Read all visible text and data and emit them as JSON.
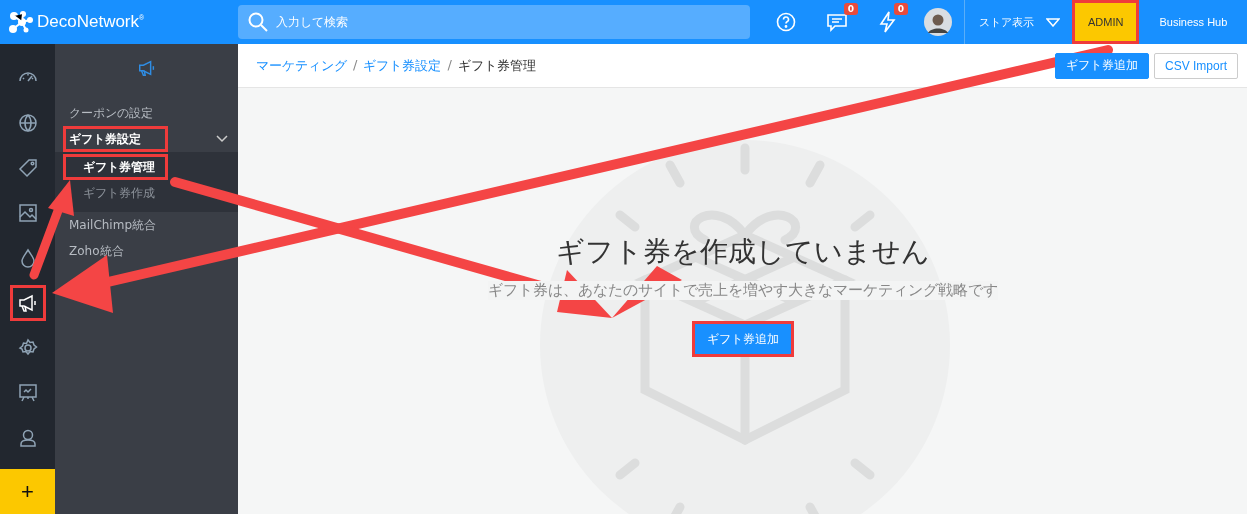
{
  "header": {
    "logo": "DecoNetwork$^{®}$",
    "search": {
      "placeholder": "入力して検索"
    },
    "messages_badge": "0",
    "alerts_badge": "0",
    "store_view": "ストア表示",
    "modes": [
      {
        "label": "ADMIN",
        "selected": true,
        "highlighted": true
      },
      {
        "label": "Business Hub",
        "selected": false,
        "highlighted": false
      }
    ]
  },
  "rail": [
    {
      "selected": false,
      "highlighted": false
    },
    {
      "selected": false,
      "highlighted": false
    },
    {
      "selected": false,
      "highlighted": false
    },
    {
      "selected": false,
      "highlighted": false
    },
    {
      "selected": false,
      "highlighted": false
    },
    {
      "selected": true,
      "highlighted": true
    },
    {
      "selected": false,
      "highlighted": false
    },
    {
      "selected": false,
      "highlighted": false
    },
    {
      "selected": false,
      "highlighted": false
    }
  ],
  "rail_add": "+",
  "submenu": [
    {
      "label": "クーポンの設定",
      "selected": false,
      "highlighted": false
    },
    {
      "label": "ギフト券設定",
      "selected": false,
      "highlighted": true,
      "expanded": true,
      "children": [
        {
          "label": "ギフト券管理",
          "selected": true,
          "highlighted": true
        },
        {
          "label": "ギフト券作成",
          "selected": false,
          "highlighted": false
        }
      ]
    },
    {
      "label": "MailChimp統合",
      "selected": false,
      "highlighted": false
    },
    {
      "label": "Zoho統合",
      "selected": false,
      "highlighted": false
    }
  ],
  "breadcrumb": [
    {
      "label": "マーケティング",
      "kind": "link"
    },
    {
      "label": "/",
      "kind": "separator"
    },
    {
      "label": "ギフト券設定",
      "kind": "link"
    },
    {
      "label": "/",
      "kind": "separator"
    },
    {
      "label": "ギフト券管理",
      "kind": "current"
    }
  ],
  "toolbar_buttons": [
    {
      "label": "ギフト券追加",
      "kind": "primary"
    },
    {
      "label": "CSV Import",
      "kind": "outline"
    }
  ],
  "empty_state": {
    "title": "ギフト券を作成していません",
    "message": "ギフト券は、あなたのサイトで売上を増やす大きなマーケティング戦略です",
    "button": {
      "label": "ギフト券追加",
      "highlighted": true
    }
  }
}
